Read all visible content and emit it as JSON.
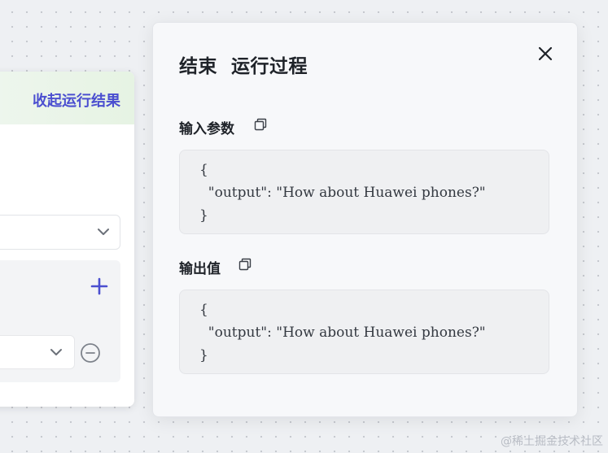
{
  "node_card": {
    "collapse_label": "收起运行结果"
  },
  "panel": {
    "title": "结束  运行过程",
    "input": {
      "title": "输入参数",
      "lines": [
        "{",
        "  \"output\": \"How about Huawei phones?\"",
        "}"
      ]
    },
    "output": {
      "title": "输出值",
      "lines": [
        "{",
        "  \"output\": \"How about Huawei phones?\"",
        "}"
      ]
    }
  },
  "watermark": "@稀土掘金技术社区",
  "colors": {
    "accent": "#4b4fd0",
    "panel_bg": "#f7f8fa",
    "code_bg": "#eff0f2",
    "result_bar": "#e6f3e3"
  },
  "icons": [
    "chevron-down-icon",
    "plus-icon",
    "minus-circle-icon",
    "close-icon",
    "copy-icon"
  ]
}
